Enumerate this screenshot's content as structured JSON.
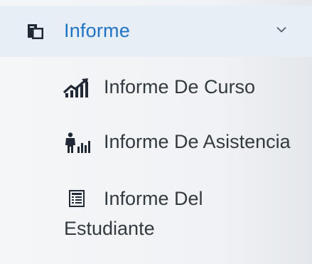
{
  "menu": {
    "title": "Informe",
    "items": [
      {
        "label": "Informe De Curso",
        "icon": "chart-growth-icon"
      },
      {
        "label": "Informe De Asistencia",
        "icon": "person-bar-chart-icon"
      },
      {
        "label_line1": "Informe Del",
        "label_line2": "Estudiante",
        "icon": "document-list-icon"
      }
    ]
  },
  "colors": {
    "accent": "#1f74c7",
    "text": "#333a40",
    "header_bg": "#e7eef5",
    "panel_bg": "#f0f2f5"
  }
}
